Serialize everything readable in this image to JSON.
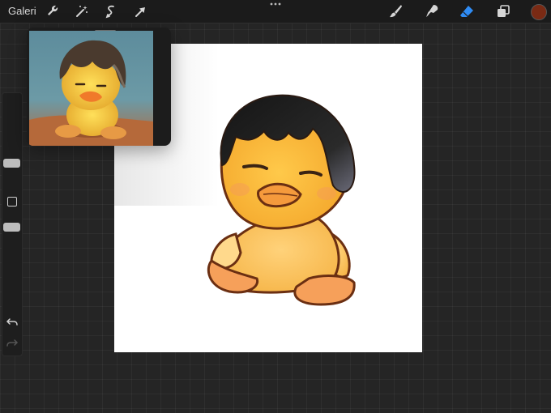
{
  "app": {
    "gallery_label": "Galeri"
  },
  "toolbar_icons": [
    "wrench-icon",
    "magic-wand-icon",
    "selection-icon",
    "transform-arrow-icon"
  ],
  "tool_icons": [
    "brush-icon",
    "smudge-icon",
    "eraser-icon",
    "layers-icon"
  ],
  "colors": {
    "current_color": "#7a2a14",
    "eraser_active": "#2f8cf5",
    "canvas_background": "#ffffff",
    "interface_background": "#252525"
  },
  "sidebar_icons": [
    "modify-square-icon",
    "undo-icon",
    "redo-icon"
  ]
}
